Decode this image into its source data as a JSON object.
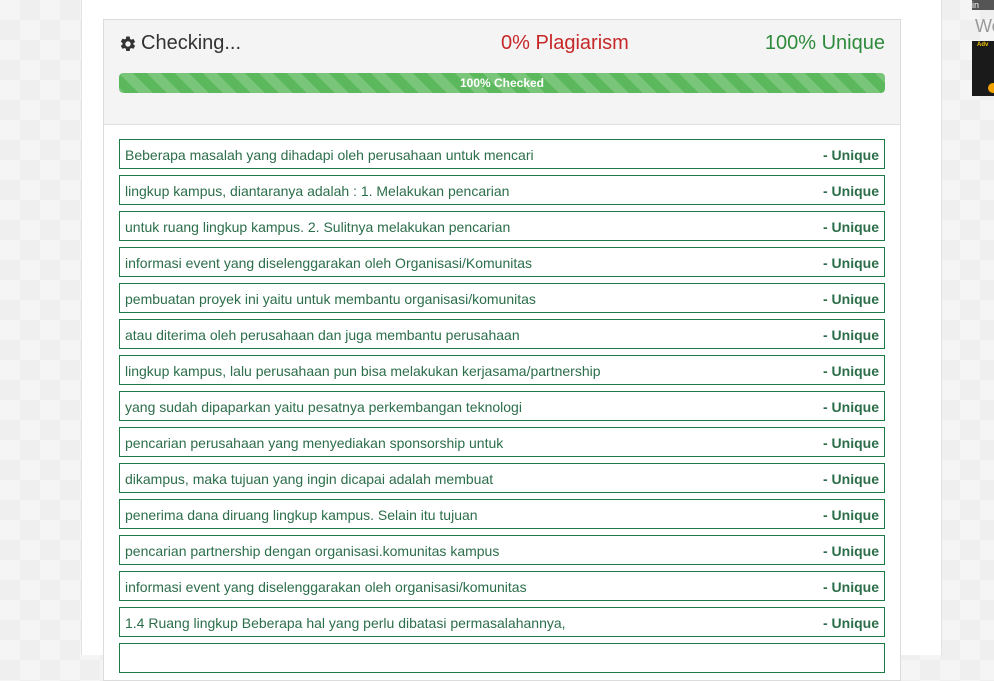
{
  "checker": {
    "status_text": "Checking...",
    "plagiarism_text": "0% Plagiarism",
    "unique_text": "100% Unique",
    "progress_label": "100% Checked",
    "progress_value": 1.0
  },
  "sentences": [
    {
      "text": "Beberapa masalah yang dihadapi oleh perusahaan untuk mencari",
      "status": "- Unique"
    },
    {
      "text": "lingkup kampus, diantaranya adalah : 1. Melakukan pencarian",
      "status": "- Unique"
    },
    {
      "text": "untuk ruang lingkup kampus. 2. Sulitnya melakukan pencarian",
      "status": "- Unique"
    },
    {
      "text": "informasi event yang diselenggarakan oleh Organisasi/Komunitas",
      "status": "- Unique"
    },
    {
      "text": "pembuatan proyek ini yaitu untuk membantu organisasi/komunitas",
      "status": "- Unique"
    },
    {
      "text": "atau diterima oleh perusahaan dan juga membantu perusahaan",
      "status": "- Unique"
    },
    {
      "text": "lingkup kampus, lalu perusahaan pun bisa melakukan kerjasama/partnership",
      "status": "- Unique"
    },
    {
      "text": "yang sudah dipaparkan yaitu pesatnya perkembangan teknologi",
      "status": "- Unique"
    },
    {
      "text": "pencarian perusahaan yang menyediakan sponsorship untuk",
      "status": "- Unique"
    },
    {
      "text": "dikampus, maka tujuan yang ingin dicapai adalah membuat",
      "status": "- Unique"
    },
    {
      "text": "penerima dana diruang lingkup kampus. Selain itu tujuan",
      "status": "- Unique"
    },
    {
      "text": "pencarian partnership dengan organisasi.komunitas kampus",
      "status": "- Unique"
    },
    {
      "text": "informasi event yang diselenggarakan oleh organisasi/komunitas",
      "status": "- Unique"
    },
    {
      "text": "1.4 Ruang lingkup Beberapa hal yang perlu dibatasi permasalahannya,",
      "status": "- Unique"
    },
    {
      "text": "",
      "status": ""
    }
  ],
  "sidebar": {
    "tab_text": "in",
    "partial_text": "We",
    "ad_label": "Adv"
  },
  "icons": {
    "status": "gear-icon"
  },
  "colors": {
    "plagiarism": "#c62828",
    "unique": "#2e8b3c",
    "progress": "#5cb85c",
    "row_border": "#1e7a46",
    "row_text": "#2c6e4a"
  }
}
